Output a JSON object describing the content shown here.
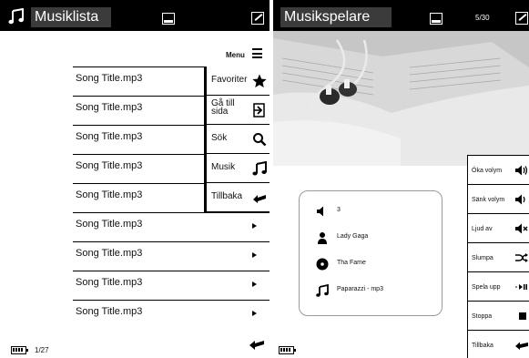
{
  "left_screen": {
    "title": "Musiklista",
    "menu_label": "Menu",
    "songs": [
      {
        "title": "Song Title.mp3"
      },
      {
        "title": "Song Title.mp3"
      },
      {
        "title": "Song Title.mp3"
      },
      {
        "title": "Song Title.mp3"
      },
      {
        "title": "Song Title.mp3"
      },
      {
        "title": "Song Title.mp3"
      },
      {
        "title": "Song Title.mp3"
      },
      {
        "title": "Song Title.mp3"
      },
      {
        "title": "Song Title.mp3"
      }
    ],
    "popup_menu": [
      {
        "label": "Favoriter",
        "icon": "star-icon"
      },
      {
        "label": "Gå till sida",
        "icon": "goto-page-icon"
      },
      {
        "label": "Sök",
        "icon": "search-icon"
      },
      {
        "label": "Musik",
        "icon": "music-note-icon"
      },
      {
        "label": "Tillbaka",
        "icon": "back-arrow-icon"
      }
    ],
    "page_indicator": "1/27"
  },
  "right_screen": {
    "title": "Musikspelare",
    "track_counter": "5/30",
    "now_playing": {
      "volume": "3",
      "artist": "Lady Gaga",
      "album": "Tha Fame",
      "track": "Paparazzi - mp3"
    },
    "controls": [
      {
        "label": "Öka volym",
        "icon": "volume-up-icon"
      },
      {
        "label": "Sänk volym",
        "icon": "volume-down-icon"
      },
      {
        "label": "Ljud av",
        "icon": "mute-icon"
      },
      {
        "label": "Slumpa",
        "icon": "shuffle-icon"
      },
      {
        "label": "Spela upp",
        "icon": "play-pause-icon"
      },
      {
        "label": "Stoppa",
        "icon": "stop-icon"
      },
      {
        "label": "Tillbaka",
        "icon": "back-arrow-icon"
      }
    ]
  }
}
